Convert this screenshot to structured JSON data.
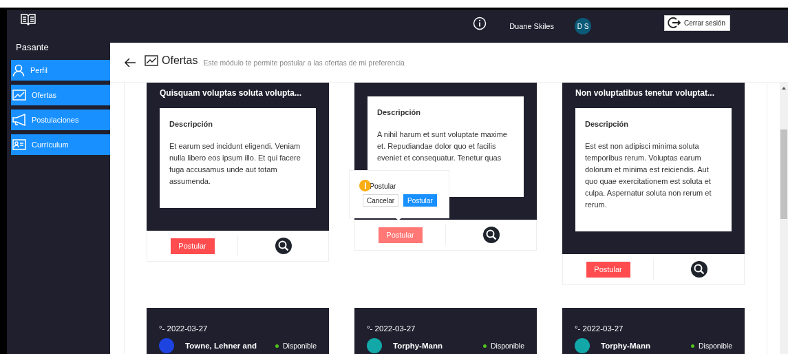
{
  "sidebar": {
    "role": "Pasante",
    "items": [
      {
        "label": "Perfil",
        "kind": "user"
      },
      {
        "label": "Ofertas",
        "kind": "chart"
      },
      {
        "label": "Postulaciones",
        "kind": "megaphone"
      },
      {
        "label": "Currículum",
        "kind": "card"
      }
    ]
  },
  "header": {
    "user_name": "Duane Skiles",
    "avatar_initials": "D S",
    "logout": "Cerrar sesión"
  },
  "page": {
    "title": "Ofertas",
    "subtitle": "Este módulo te permite postular a las ofertas de mi preferencia"
  },
  "offers": [
    {
      "title": "Quisquam voluptas soluta volupta...",
      "description_label": "Descripción",
      "description": "Et earum sed incidunt eligendi. Veniam nulla libero eos ipsum illo. Et qui facere fuga accusamus unde aut totam assumenda.",
      "apply": "Postular",
      "pressed": false
    },
    {
      "description_label": "Descripción",
      "description": "A nihil harum et sunt voluptate maxime et. Repudiandae dolor quo et facilis eveniet et consequatur. Tenetur quas",
      "apply": "Postular",
      "pressed": true,
      "popconfirm": {
        "message": "Postular",
        "cancel": "Cancelar",
        "ok": "Postular"
      }
    },
    {
      "title": "Non voluptatibus tenetur voluptat...",
      "description_label": "Descripción",
      "description": "Est est non adipisci minima soluta temporibus rerum. Voluptas earum dolorum et minima est reiciendis. Aut quo quae exercitationem est soluta et culpa. Aspernatur soluta non rerum et rerum.",
      "apply": "Postular",
      "pressed": false
    }
  ],
  "offers_row_2": [
    {
      "date": "°- 2022-03-27",
      "company": "Towne, Lehner and",
      "status": "Disponible",
      "color": "#1d43e0"
    },
    {
      "date": "°- 2022-03-27",
      "company": "Torphy-Mann",
      "status": "Disponible",
      "color": "#13a8a8"
    },
    {
      "date": "°- 2022-03-27",
      "company": "Torphy-Mann",
      "status": "Disponible",
      "color": "#13a8a8"
    }
  ]
}
